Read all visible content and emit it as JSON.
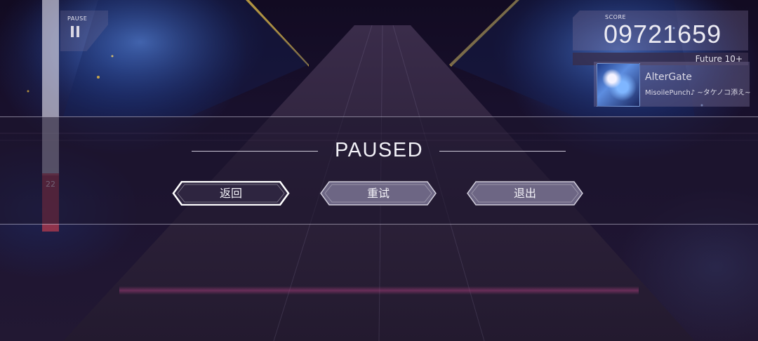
{
  "hud": {
    "pause_label": "PAUSE",
    "health_value": "22",
    "health_fraction": 0.25,
    "score_label": "SCORE",
    "score": "09721659",
    "difficulty": "Future 10+"
  },
  "song": {
    "title": "AlterGate",
    "artist": "MisoilePunch♪ ~タケノコ添え~"
  },
  "pause_menu": {
    "title": "PAUSED",
    "buttons": [
      {
        "label": "返回",
        "selected": true
      },
      {
        "label": "重试",
        "selected": false
      },
      {
        "label": "退出",
        "selected": false
      }
    ]
  },
  "colors": {
    "track": "#2b2038",
    "accent_gold": "#d8b548",
    "button_fill": "#6d6684",
    "button_fill_selected": "#2e2540",
    "text": "#f2f1f7"
  },
  "icons": {
    "pause": "pause-icon"
  }
}
